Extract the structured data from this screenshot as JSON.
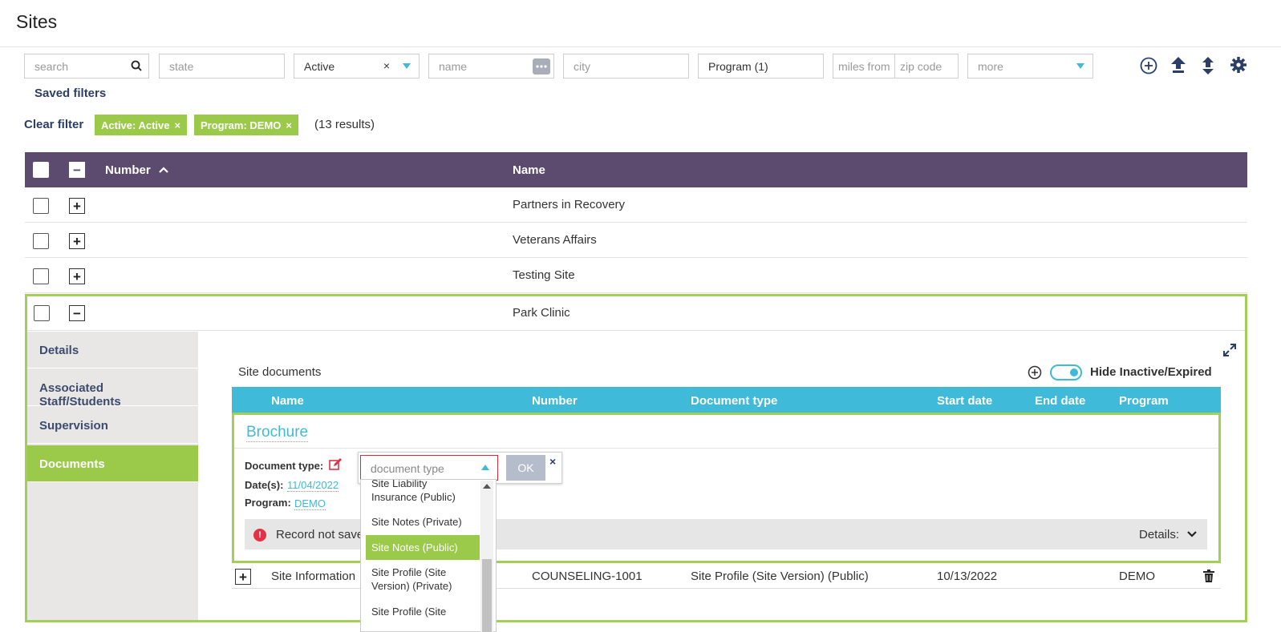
{
  "page_title": "Sites",
  "filters": {
    "search_placeholder": "search",
    "state_placeholder": "state",
    "status_value": "Active",
    "status_clear": "×",
    "name_placeholder": "name",
    "city_placeholder": "city",
    "program_value": "Program (1)",
    "miles_placeholder": "miles from",
    "zip_placeholder": "zip code",
    "more_placeholder": "more"
  },
  "saved_filters": "Saved filters",
  "clear_filter": "Clear filter",
  "chips": [
    {
      "label": "Active: Active",
      "x": "×"
    },
    {
      "label": "Program: DEMO",
      "x": "×"
    }
  ],
  "results": "(13 results)",
  "table": {
    "col_number": "Number",
    "col_name": "Name",
    "rows": [
      {
        "name": "Partners in Recovery"
      },
      {
        "name": "Veterans Affairs"
      },
      {
        "name": "Testing Site"
      },
      {
        "name": "Park Clinic"
      }
    ]
  },
  "sidebar": {
    "items": [
      {
        "label": "Details"
      },
      {
        "label": "Associated Staff/Students"
      },
      {
        "label": "Supervision"
      },
      {
        "label": "Documents"
      }
    ]
  },
  "docs": {
    "title": "Site documents",
    "hide_label": "Hide Inactive/Expired",
    "headers": {
      "name": "Name",
      "number": "Number",
      "doc_type": "Document type",
      "start": "Start date",
      "end": "End date",
      "program": "Program"
    },
    "brochure": {
      "title": "Brochure",
      "doc_type_label": "Document type:",
      "dates_label": "Date(s):",
      "dates_value": "11/04/2022",
      "program_label": "Program:",
      "program_value": "DEMO",
      "error_text": "Record not save",
      "details_label": "Details:"
    },
    "row": {
      "name": "Site Information",
      "number": "COUNSELING-1001",
      "doc_type": "Site Profile (Site Version) (Public)",
      "start": "10/13/2022",
      "program": "DEMO"
    }
  },
  "dropdown": {
    "placeholder": "document type",
    "ok": "OK",
    "close": "×",
    "options": [
      {
        "l1": "Site Liability",
        "l2": "Insurance (Public)"
      },
      {
        "l1": "Site Notes (Private)",
        "l2": ""
      },
      {
        "l1": "Site Notes (Public)",
        "l2": ""
      },
      {
        "l1": "Site Profile (Site",
        "l2": "Version) (Private)"
      },
      {
        "l1": "Site Profile (Site",
        "l2": ""
      }
    ]
  },
  "colors": {
    "header": "#5c4b6e",
    "accent_green": "#9bc94a",
    "accent_blue": "#3fbad8",
    "error": "#e53046"
  }
}
